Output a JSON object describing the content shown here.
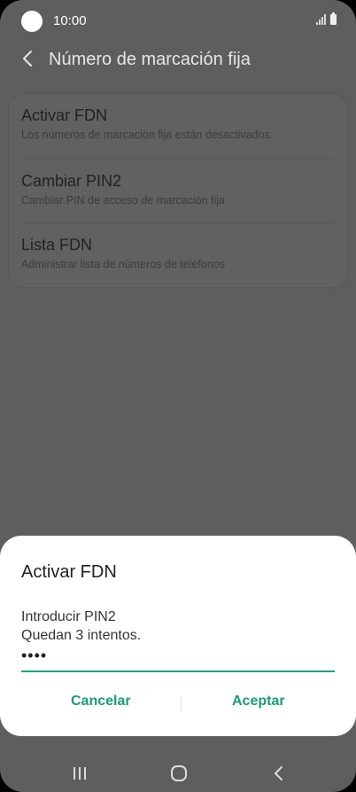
{
  "status_bar": {
    "time": "10:00",
    "icons": [
      "camera-cutout",
      "signal-icon",
      "battery-icon"
    ]
  },
  "header": {
    "title": "Número de marcación fija",
    "back_icon": "chevron-left-icon"
  },
  "settings": {
    "items": [
      {
        "title": "Activar FDN",
        "subtitle": "Los números de marcación fija están desactivados."
      },
      {
        "title": "Cambiar PIN2",
        "subtitle": "Cambiar PIN de acceso de marcación fija"
      },
      {
        "title": "Lista FDN",
        "subtitle": "Administrar lista de números de teléfonos"
      }
    ]
  },
  "dialog": {
    "title": "Activar FDN",
    "message_line1": "Introducir PIN2",
    "message_line2": "Quedan 3 intentos.",
    "pin_value": "••••",
    "cancel_label": "Cancelar",
    "accept_label": "Aceptar",
    "accent_color": "#1a9b74"
  },
  "nav_bar": {
    "icons": [
      "recent-apps-icon",
      "home-icon",
      "back-icon"
    ]
  }
}
